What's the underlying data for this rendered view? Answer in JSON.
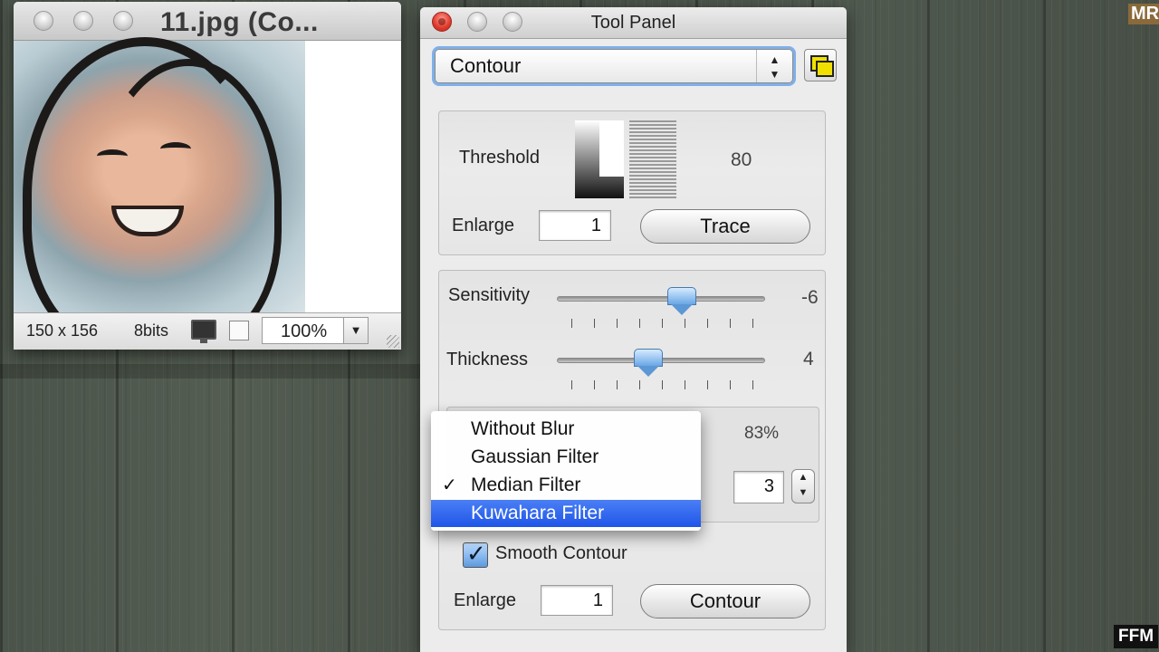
{
  "image_window": {
    "title": "11.jpg (Co...",
    "dimensions": "150 x 156",
    "bit_depth": "8bits",
    "zoom": "100%"
  },
  "tool_panel": {
    "title": "Tool Panel",
    "mode_select": "Contour",
    "threshold": {
      "label": "Threshold",
      "value": "80",
      "enlarge_label": "Enlarge",
      "enlarge_value": "1",
      "trace_button": "Trace"
    },
    "sensitivity": {
      "label": "Sensitivity",
      "value": "-6",
      "position": 0.6
    },
    "thickness": {
      "label": "Thickness",
      "value": "4",
      "position": 0.44
    },
    "blur": {
      "percent": "83%",
      "stepper_value": "3"
    },
    "smooth_contour": {
      "label": "Smooth Contour",
      "checked": true
    },
    "contour": {
      "enlarge_label": "Enlarge",
      "enlarge_value": "1",
      "contour_button": "Contour"
    }
  },
  "filter_menu": {
    "items": [
      {
        "label": "Without Blur",
        "checked": false,
        "highlighted": false
      },
      {
        "label": "Gaussian Filter",
        "checked": false,
        "highlighted": false
      },
      {
        "label": "Median Filter",
        "checked": true,
        "highlighted": false
      },
      {
        "label": "Kuwahara Filter",
        "checked": false,
        "highlighted": true
      }
    ],
    "check_glyph": "✓"
  },
  "watermarks": {
    "top_right": "MR",
    "bottom_right": "FFM"
  },
  "colors": {
    "accent": "#1f55e8",
    "close": "#e0382a",
    "focus_ring": "#7fb0ea"
  }
}
